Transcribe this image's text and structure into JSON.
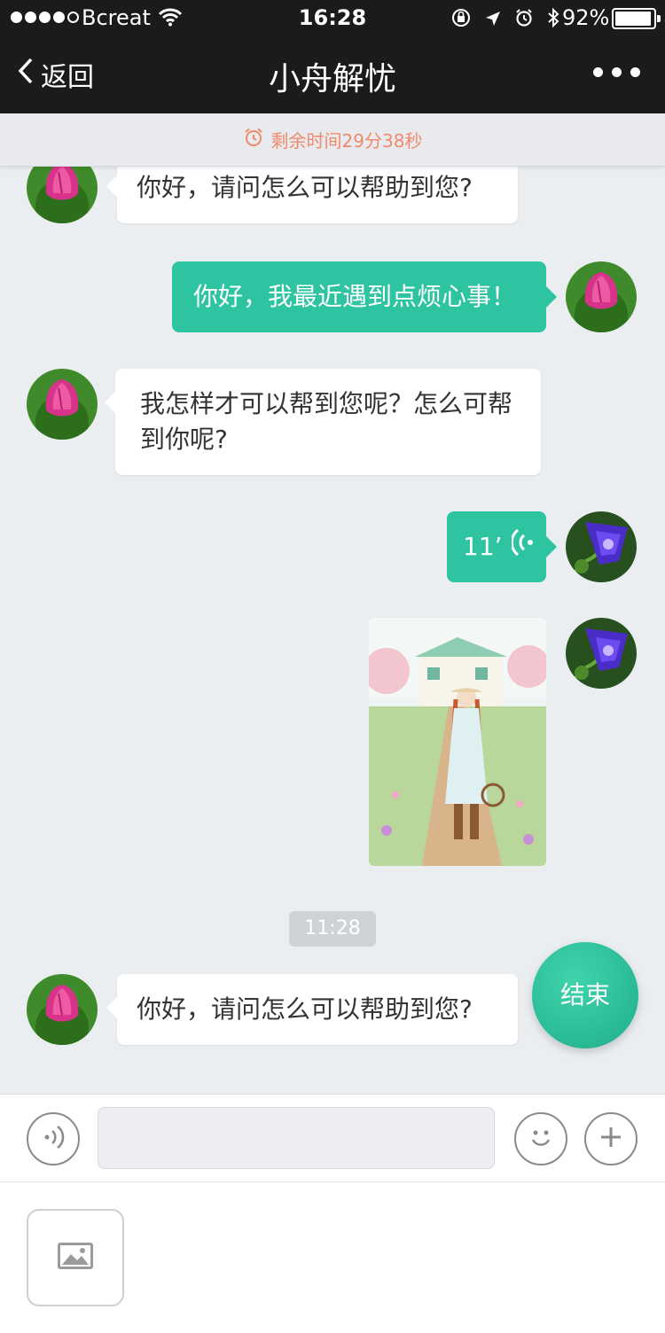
{
  "status": {
    "carrier": "Bcreat",
    "time": "16:28",
    "battery": "92%",
    "battery_level": 0.92
  },
  "nav": {
    "back_label": "返回",
    "title": "小舟解忧"
  },
  "timer": {
    "text": "剩余时间29分38秒"
  },
  "messages": [
    {
      "text": "你好，请问怎么可以帮助到您?"
    },
    {
      "text": "你好，我最近遇到点烦心事！"
    },
    {
      "text": "我怎样才可以帮到您呢？怎么可帮到你呢?"
    },
    {
      "voice_duration": "11’"
    },
    {
      "image": "illustration"
    },
    {
      "text": "你好，请问怎么可以帮助到您?"
    }
  ],
  "timestamp": "11:28",
  "end_button": "结束",
  "colors": {
    "accent": "#2ec4a1",
    "timer_text": "#f08a6d",
    "nav_bg": "#1b1b1d",
    "chat_bg": "#ebeef1"
  }
}
